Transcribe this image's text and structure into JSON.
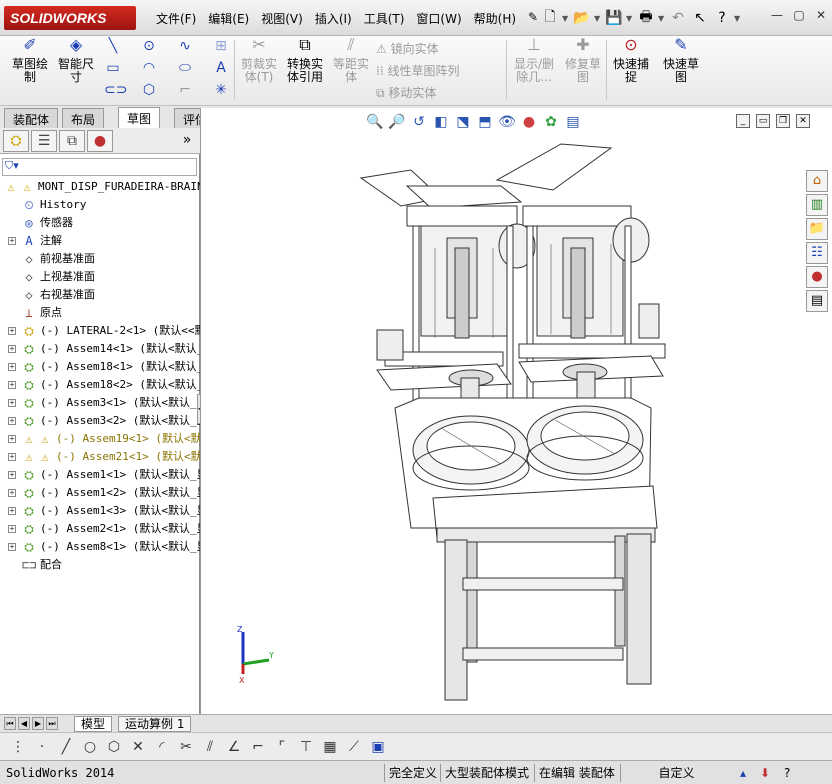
{
  "app": {
    "logo": "SOLIDWORKS"
  },
  "menu": [
    "文件(F)",
    "编辑(E)",
    "视图(V)",
    "插入(I)",
    "工具(T)",
    "窗口(W)",
    "帮助(H)"
  ],
  "command_manager": {
    "sketch": "草图绘\n制",
    "smart_dim": "智能尺\n寸",
    "trim": "剪裁实\n体(T)",
    "convert": "转换实\n体引用",
    "offset": "等距实\n体",
    "mirror": "镜向实体",
    "linear_pattern": "线性草图阵列",
    "move": "移动实体",
    "display_delete": "显示/删\n除几...",
    "repair": "修复草\n图",
    "quick_snap": "快速捕\n捉",
    "rapid_sketch": "快速草\n图"
  },
  "tabs": [
    "装配体",
    "布局",
    "草图",
    "评估"
  ],
  "active_tab": "草图",
  "tree": {
    "root": "MONT_DISP_FURADEIRA-BRAINC",
    "items": [
      {
        "label": "History",
        "icon": "history-icon"
      },
      {
        "label": "传感器",
        "icon": "sensor-icon"
      },
      {
        "label": "注解",
        "icon": "annotation-icon",
        "expand": "+"
      },
      {
        "label": "前视基准面",
        "icon": "plane-icon"
      },
      {
        "label": "上视基准面",
        "icon": "plane-icon"
      },
      {
        "label": "右视基准面",
        "icon": "plane-icon"
      },
      {
        "label": "原点",
        "icon": "origin-icon"
      },
      {
        "label": "(-) LATERAL-2<1> (默认<<默认",
        "icon": "part-icon",
        "expand": "+"
      },
      {
        "label": "(-) Assem14<1> (默认<默认_",
        "icon": "assembly-icon",
        "expand": "+"
      },
      {
        "label": "(-) Assem18<1> (默认<默认_",
        "icon": "assembly-icon",
        "expand": "+"
      },
      {
        "label": "(-) Assem18<2> (默认<默认_",
        "icon": "assembly-icon",
        "expand": "+"
      },
      {
        "label": "(-) Assem3<1> (默认<默认_显",
        "icon": "assembly-icon",
        "expand": "+"
      },
      {
        "label": "(-) Assem3<2> (默认<默认_显",
        "icon": "assembly-icon",
        "expand": "+"
      },
      {
        "label": "(-) Assem19<1> (默认<默",
        "icon": "assembly-warning-icon",
        "expand": "+",
        "warn": true
      },
      {
        "label": "(-) Assem21<1> (默认<默",
        "icon": "assembly-warning-icon",
        "expand": "+",
        "warn": true
      },
      {
        "label": "(-) Assem1<1> (默认<默认_显",
        "icon": "assembly-icon",
        "expand": "+"
      },
      {
        "label": "(-) Assem1<2> (默认<默认_显",
        "icon": "assembly-icon",
        "expand": "+"
      },
      {
        "label": "(-) Assem1<3> (默认<默认_显",
        "icon": "assembly-icon",
        "expand": "+"
      },
      {
        "label": "(-) Assem2<1> (默认<默认_显",
        "icon": "assembly-icon",
        "expand": "+"
      },
      {
        "label": "(-) Assem8<1> (默认<默认_显",
        "icon": "assembly-icon",
        "expand": "+"
      },
      {
        "label": "配合",
        "icon": "mates-icon"
      }
    ]
  },
  "triad": {
    "x": "X",
    "y": "Y",
    "z": "Z"
  },
  "bottom_tabs": [
    "模型",
    "运动算例 1"
  ],
  "status": {
    "app": "SolidWorks 2014",
    "defined": "完全定义",
    "mode": "大型装配体模式",
    "editing": "在编辑 装配体",
    "custom": "自定义"
  }
}
